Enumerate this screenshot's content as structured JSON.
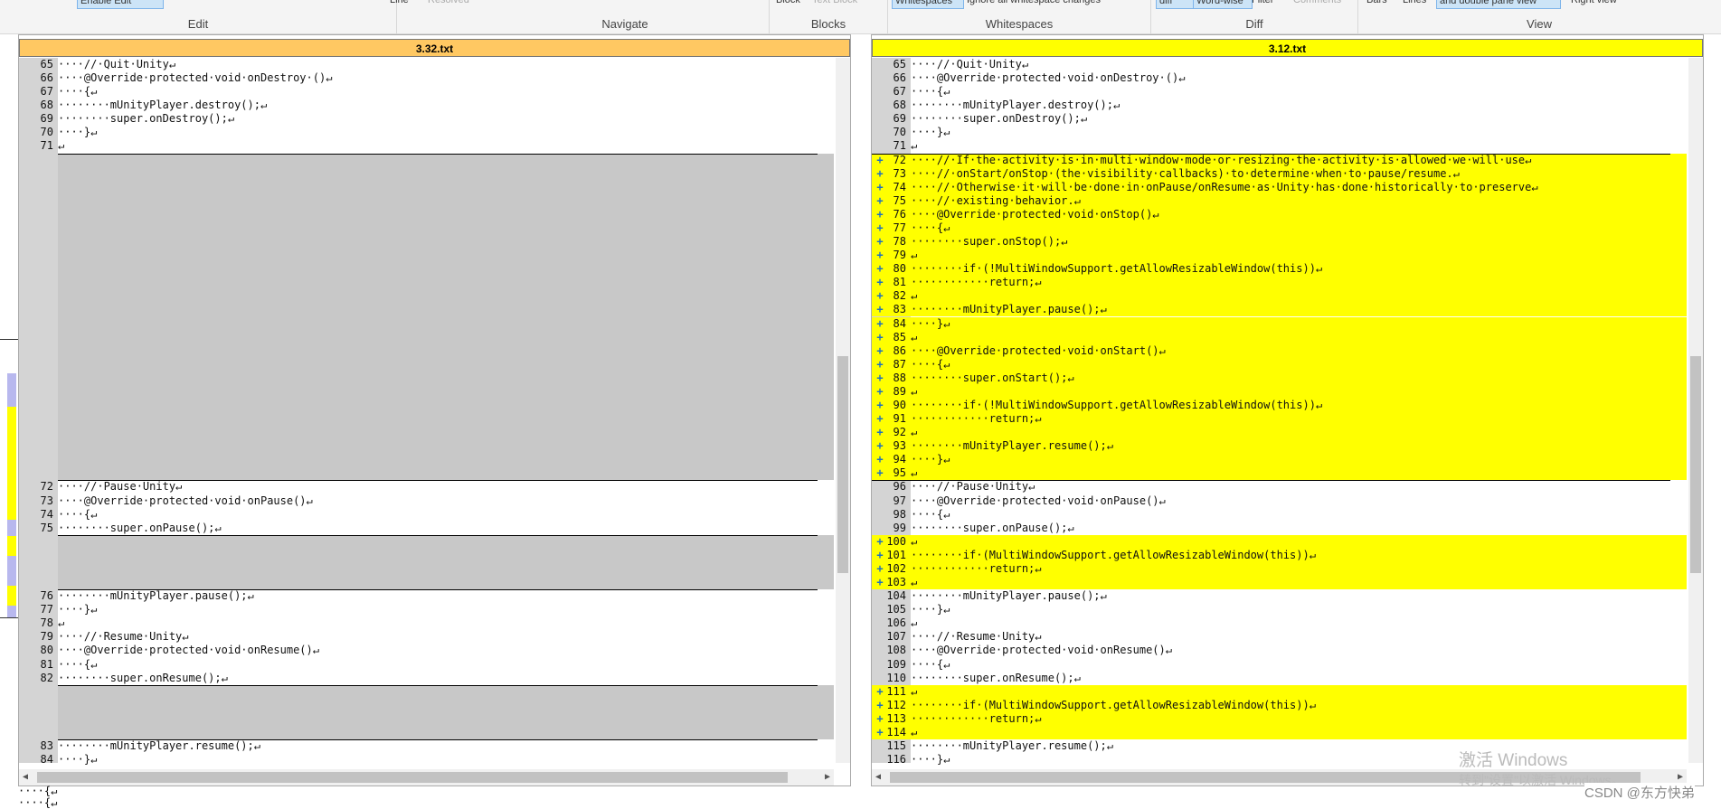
{
  "ribbon": {
    "groups": [
      {
        "label": "Edit",
        "buttons": [
          "Enable Edit",
          "Line",
          "Resolved"
        ]
      },
      {
        "label": "Navigate",
        "buttons": []
      },
      {
        "label": "Blocks",
        "buttons": [
          "Block",
          "Text Block"
        ]
      },
      {
        "label": "Whitespaces",
        "buttons": [
          "Whitespaces",
          "Ignore all whitespace changes"
        ]
      },
      {
        "label": "Diff",
        "buttons": [
          "diff",
          "Word-wise",
          "Filter",
          "Comments"
        ]
      },
      {
        "label": "View",
        "buttons": [
          "Bars",
          "Lines",
          "and double pane view",
          "Right view"
        ]
      }
    ]
  },
  "left_pane": {
    "title": "3.32.txt",
    "title_color": "#ffc862",
    "rows": [
      {
        "n": "65",
        "t": "····//·Quit·Unity↵"
      },
      {
        "n": "66",
        "t": "····@Override·protected·void·onDestroy·()↵"
      },
      {
        "n": "67",
        "t": "····{↵"
      },
      {
        "n": "68",
        "t": "········mUnityPlayer.destroy();↵"
      },
      {
        "n": "69",
        "t": "········super.onDestroy();↵"
      },
      {
        "n": "70",
        "t": "····}↵"
      },
      {
        "n": "71",
        "t": "↵"
      },
      {
        "gap": 24
      },
      {
        "n": "72",
        "t": "····//·Pause·Unity↵"
      },
      {
        "n": "73",
        "t": "····@Override·protected·void·onPause()↵"
      },
      {
        "n": "74",
        "t": "····{↵"
      },
      {
        "n": "75",
        "t": "········super.onPause();↵"
      },
      {
        "gap": 4
      },
      {
        "n": "76",
        "t": "········mUnityPlayer.pause();↵"
      },
      {
        "n": "77",
        "t": "····}↵"
      },
      {
        "n": "78",
        "t": "↵"
      },
      {
        "n": "79",
        "t": "····//·Resume·Unity↵"
      },
      {
        "n": "80",
        "t": "····@Override·protected·void·onResume()↵"
      },
      {
        "n": "81",
        "t": "····{↵"
      },
      {
        "n": "82",
        "t": "········super.onResume();↵"
      },
      {
        "gap": 4
      },
      {
        "n": "83",
        "t": "········mUnityPlayer.resume();↵"
      },
      {
        "n": "84",
        "t": "····}↵"
      }
    ]
  },
  "right_pane": {
    "title": "3.12.txt",
    "title_color": "#ffff00",
    "rows": [
      {
        "n": "65",
        "t": "····//·Quit·Unity↵"
      },
      {
        "n": "66",
        "t": "····@Override·protected·void·onDestroy·()↵"
      },
      {
        "n": "67",
        "t": "····{↵"
      },
      {
        "n": "68",
        "t": "········mUnityPlayer.destroy();↵"
      },
      {
        "n": "69",
        "t": "········super.onDestroy();↵"
      },
      {
        "n": "70",
        "t": "····}↵"
      },
      {
        "n": "71",
        "t": "↵"
      },
      {
        "n": "72",
        "t": "····//·If·the·activity·is·in·multi·window·mode·or·resizing·the·activity·is·allowed·we·will·use↵",
        "add": true
      },
      {
        "n": "73",
        "t": "····//·onStart/onStop·(the·visibility·callbacks)·to·determine·when·to·pause/resume.↵",
        "add": true
      },
      {
        "n": "74",
        "t": "····//·Otherwise·it·will·be·done·in·onPause/onResume·as·Unity·has·done·historically·to·preserve↵",
        "add": true
      },
      {
        "n": "75",
        "t": "····//·existing·behavior.↵",
        "add": true
      },
      {
        "n": "76",
        "t": "····@Override·protected·void·onStop()↵",
        "add": true
      },
      {
        "n": "77",
        "t": "····{↵",
        "add": true
      },
      {
        "n": "78",
        "t": "········super.onStop();↵",
        "add": true
      },
      {
        "n": "79",
        "t": "↵",
        "add": true
      },
      {
        "n": "80",
        "t": "········if·(!MultiWindowSupport.getAllowResizableWindow(this))↵",
        "add": true
      },
      {
        "n": "81",
        "t": "············return;↵",
        "add": true
      },
      {
        "n": "82",
        "t": "↵",
        "add": true
      },
      {
        "n": "83",
        "t": "········mUnityPlayer.pause();↵",
        "add": true
      },
      {
        "n": "84",
        "t": "····}↵",
        "add": true
      },
      {
        "n": "85",
        "t": "↵",
        "add": true
      },
      {
        "n": "86",
        "t": "····@Override·protected·void·onStart()↵",
        "add": true
      },
      {
        "n": "87",
        "t": "····{↵",
        "add": true
      },
      {
        "n": "88",
        "t": "········super.onStart();↵",
        "add": true
      },
      {
        "n": "89",
        "t": "↵",
        "add": true
      },
      {
        "n": "90",
        "t": "········if·(!MultiWindowSupport.getAllowResizableWindow(this))↵",
        "add": true
      },
      {
        "n": "91",
        "t": "············return;↵",
        "add": true
      },
      {
        "n": "92",
        "t": "↵",
        "add": true
      },
      {
        "n": "93",
        "t": "········mUnityPlayer.resume();↵",
        "add": true
      },
      {
        "n": "94",
        "t": "····}↵",
        "add": true
      },
      {
        "n": "95",
        "t": "↵",
        "add": true
      },
      {
        "n": "96",
        "t": "····//·Pause·Unity↵"
      },
      {
        "n": "97",
        "t": "····@Override·protected·void·onPause()↵"
      },
      {
        "n": "98",
        "t": "····{↵"
      },
      {
        "n": "99",
        "t": "········super.onPause();↵"
      },
      {
        "n": "100",
        "t": "↵",
        "add": true
      },
      {
        "n": "101",
        "t": "········if·(MultiWindowSupport.getAllowResizableWindow(this))↵",
        "add": true
      },
      {
        "n": "102",
        "t": "············return;↵",
        "add": true
      },
      {
        "n": "103",
        "t": "↵",
        "add": true
      },
      {
        "n": "104",
        "t": "········mUnityPlayer.pause();↵"
      },
      {
        "n": "105",
        "t": "····}↵"
      },
      {
        "n": "106",
        "t": "↵"
      },
      {
        "n": "107",
        "t": "····//·Resume·Unity↵"
      },
      {
        "n": "108",
        "t": "····@Override·protected·void·onResume()↵"
      },
      {
        "n": "109",
        "t": "····{↵"
      },
      {
        "n": "110",
        "t": "········super.onResume();↵"
      },
      {
        "n": "111",
        "t": "↵",
        "add": true
      },
      {
        "n": "112",
        "t": "········if·(MultiWindowSupport.getAllowResizableWindow(this))↵",
        "add": true
      },
      {
        "n": "113",
        "t": "············return;↵",
        "add": true
      },
      {
        "n": "114",
        "t": "↵",
        "add": true
      },
      {
        "n": "115",
        "t": "········mUnityPlayer.resume();↵"
      },
      {
        "n": "116",
        "t": "····}↵"
      }
    ]
  },
  "add_marker": "+",
  "bottom_lines": [
    "····{↵",
    "····{↵"
  ],
  "watermark": {
    "line1": "激活 Windows",
    "line2": "转到\"设置\"以激活 Windows。",
    "credit": "CSDN @东方快弟"
  },
  "colors": {
    "added": "#ffff00",
    "missing": "#c8c8c8",
    "gutter": "#d4d4d4",
    "marker": "#1e6fbf"
  }
}
